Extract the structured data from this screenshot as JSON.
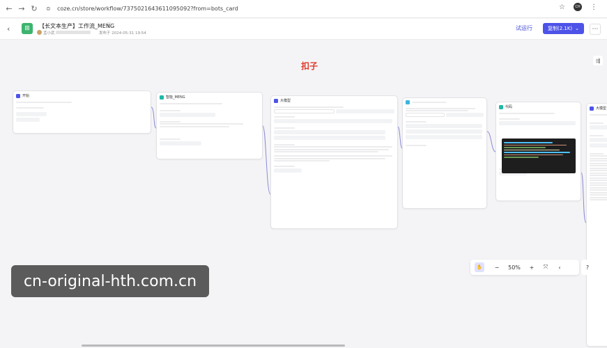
{
  "browser": {
    "url": "coze.cn/store/workflow/7375021643611095092?from=bots_card",
    "avatar_text": "CH"
  },
  "header": {
    "title": "【长文本生产】工作流_MENG",
    "author": "孟小武",
    "publish_time": "发布于 2024-05-31 19:54",
    "try_label": "试运行",
    "copy_label": "复制(2.1K)"
  },
  "canvas": {
    "brand_text": "扣子"
  },
  "nodes": [
    {
      "id": "start",
      "title": "开始",
      "color": "#4d53e8"
    },
    {
      "id": "llm-main",
      "title": "智能_MENG",
      "color": "#1fb8a8"
    },
    {
      "id": "llm-2",
      "title": "大模型",
      "color": "#4d53e8"
    },
    {
      "id": "loop",
      "title": "",
      "color": "#3cb4e0"
    },
    {
      "id": "code",
      "title": "代码",
      "color": "#1fb8a8"
    },
    {
      "id": "end-llm",
      "title": "大模型",
      "color": "#4d53e8"
    }
  ],
  "zoom": {
    "level": "50%"
  },
  "watermark": "cn-original-hth.com.cn"
}
